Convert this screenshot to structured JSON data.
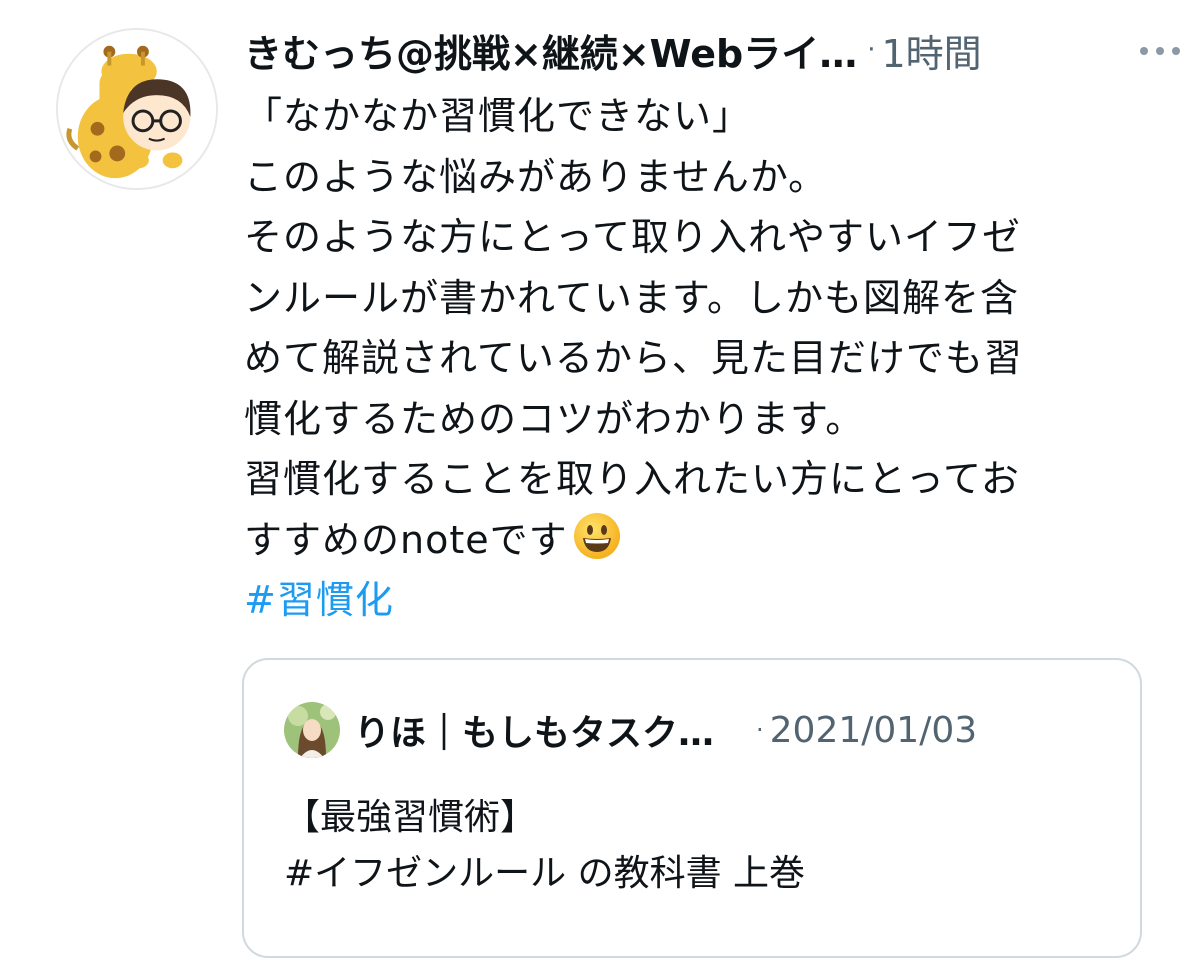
{
  "tweet": {
    "author_avatar_icon": "giraffe-character-avatar-icon",
    "display_name": "きむっち@挑戦×継続×Webライ…",
    "separator": "·",
    "timestamp": "1時間",
    "more_icon": "more-horizontal-icon",
    "body_lines": [
      "「なかなか習慣化できない」",
      "このような悩みがありませんか。",
      "そのような方にとって取り入れやすいイフゼ",
      "ンルールが書かれています。しかも図解を含",
      "めて解説されているから、見た目だけでも習",
      "慣化するためのコツがわかります。",
      "習慣化することを取り入れたい方にとってお",
      "すすめのnoteです"
    ],
    "emoji_icon": "grinning-face-emoji-icon",
    "hashtag": "#習慣化"
  },
  "quoted_tweet": {
    "avatar_icon": "user-photo-avatar-icon",
    "display_name": "りほ｜もしもタスク…",
    "separator": "·",
    "date": "2021/01/03",
    "body_lines": [
      "【最強習慣術】",
      "#イフゼンルール の教科書 上巻"
    ]
  },
  "colors": {
    "text_primary": "#0f1419",
    "text_secondary": "#536471",
    "link": "#1d9bf0",
    "card_border": "#cfd9de"
  }
}
